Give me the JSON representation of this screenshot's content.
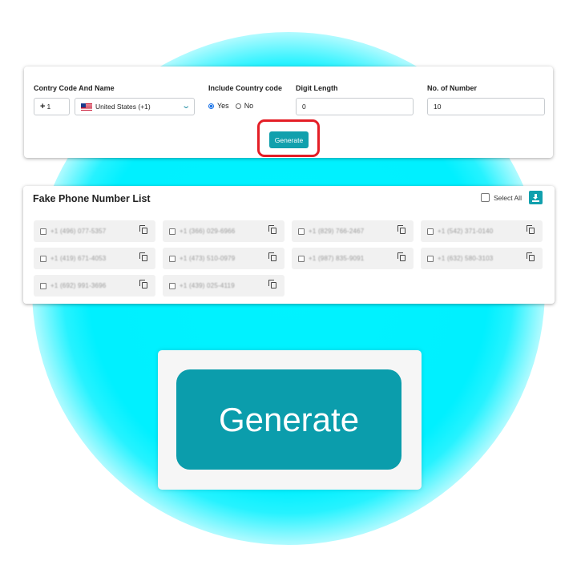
{
  "form": {
    "country_label": "Contry Code And Name",
    "country_code_prefix": "+",
    "country_code_value": "1",
    "country_select_value": "United States (+1)",
    "include_label": "Include Country code",
    "yes_label": "Yes",
    "no_label": "No",
    "include_selected": "Yes",
    "digit_label": "Digit Length",
    "digit_value": "0",
    "count_label": "No. of Number",
    "count_value": "10",
    "generate_label": "Generate"
  },
  "list": {
    "title": "Fake Phone Number List",
    "select_all_label": "Select All",
    "numbers": [
      "+1 (496) 077-5357",
      "+1 (366) 029-6966",
      "+1 (829) 766-2467",
      "+1 (542) 371-0140",
      "+1 (419) 671-4053",
      "+1 (473) 510-0979",
      "+1 (987) 835-9091",
      "+1 (632) 580-3103",
      "+1 (692) 991-3696",
      "+1 (439) 025-4119"
    ]
  },
  "zoom": {
    "generate_label": "Generate"
  },
  "colors": {
    "accent": "#11a0ad",
    "highlight": "#e41e26",
    "glow": "#00f0ff"
  }
}
